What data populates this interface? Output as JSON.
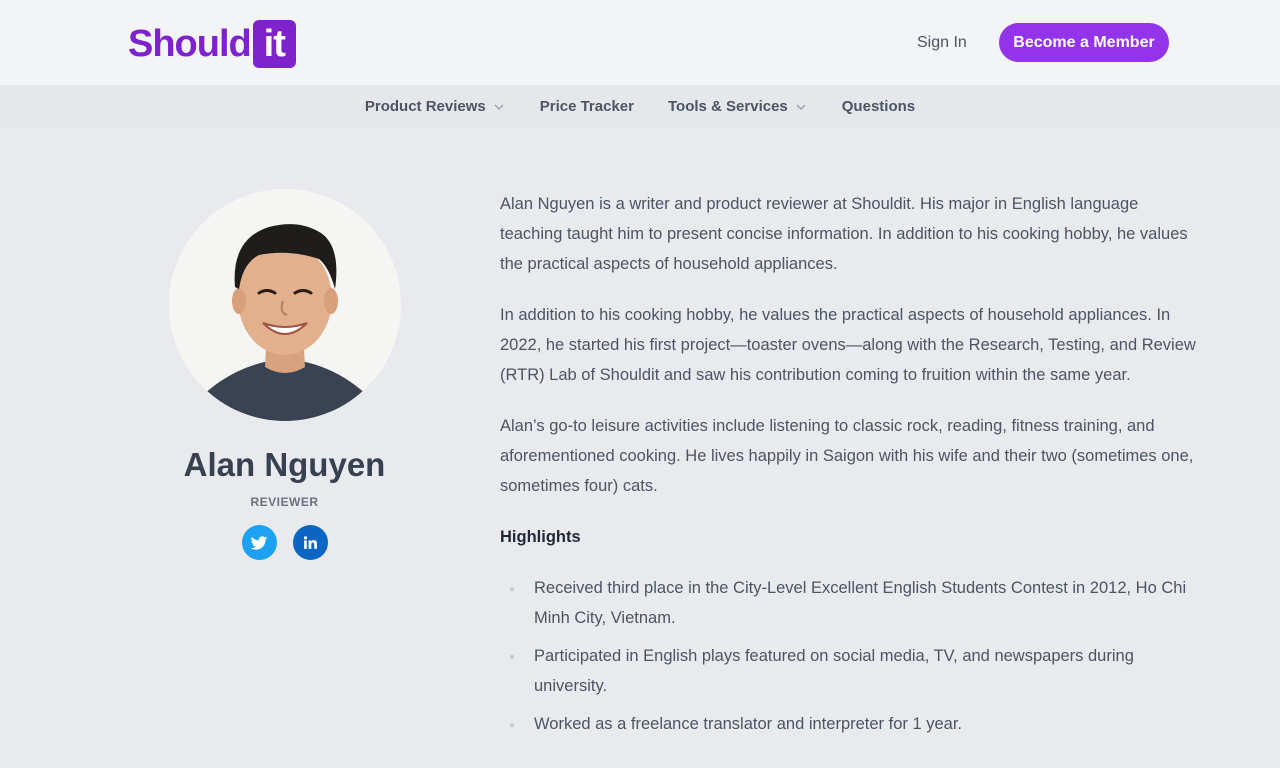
{
  "header": {
    "logo_text": "Should",
    "logo_box_text": "it",
    "signin_label": "Sign In",
    "member_label": "Become a Member"
  },
  "nav": {
    "items": [
      {
        "label": "Product Reviews",
        "has_dropdown": true
      },
      {
        "label": "Price Tracker",
        "has_dropdown": false
      },
      {
        "label": "Tools & Services",
        "has_dropdown": true
      },
      {
        "label": "Questions",
        "has_dropdown": false
      }
    ]
  },
  "profile": {
    "name": "Alan Nguyen",
    "role": "REVIEWER",
    "socials": [
      {
        "icon": "twitter-icon",
        "color": "#1da1f2"
      },
      {
        "icon": "linkedin-icon",
        "color": "#0a66c2"
      }
    ]
  },
  "bio": {
    "paragraphs": [
      "Alan Nguyen is a writer and product reviewer at Shouldit. His major in English language teaching taught him to present concise information. In addition to his cooking hobby, he values the practical aspects of household appliances.",
      "In addition to his cooking hobby, he values the practical aspects of household appliances. In 2022, he started his first project—toaster ovens—along with the Research, Testing, and Review (RTR) Lab of Shouldit and saw his contribution coming to fruition within the same year.",
      "Alan’s go-to leisure activities include listening to classic rock, reading, fitness training, and aforementioned cooking. He lives happily in Saigon with his wife and their two (sometimes one, sometimes four) cats."
    ],
    "highlights_title": "Highlights",
    "highlights": [
      "Received third place in the City-Level Excellent English Students Contest in 2012, Ho Chi Minh City, Vietnam.",
      "Participated in English plays featured on social media, TV, and newspapers during university.",
      "Worked as a freelance translator and interpreter for 1 year."
    ]
  },
  "colors": {
    "brand": "#7e22ce",
    "button": "#9333ea",
    "background": "#e9eaee"
  }
}
